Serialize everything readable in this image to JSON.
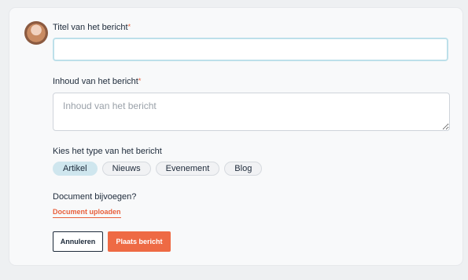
{
  "form": {
    "title_label": "Titel van het bericht",
    "title_value": "",
    "content_label": "Inhoud van het bericht",
    "content_placeholder": "Inhoud van het bericht",
    "required_mark": "*",
    "type_label": "Kies het type van het bericht",
    "types": [
      "Artikel",
      "Nieuws",
      "Evenement",
      "Blog"
    ],
    "selected_type": "Artikel",
    "attach_label": "Document bijvoegen?",
    "upload_link": "Document uploaden",
    "cancel_label": "Annuleren",
    "post_label": "Plaats bericht"
  },
  "colors": {
    "accent": "#ee6a44",
    "chip_selected": "#cfe6ee",
    "focus_border": "#bde0ea"
  }
}
